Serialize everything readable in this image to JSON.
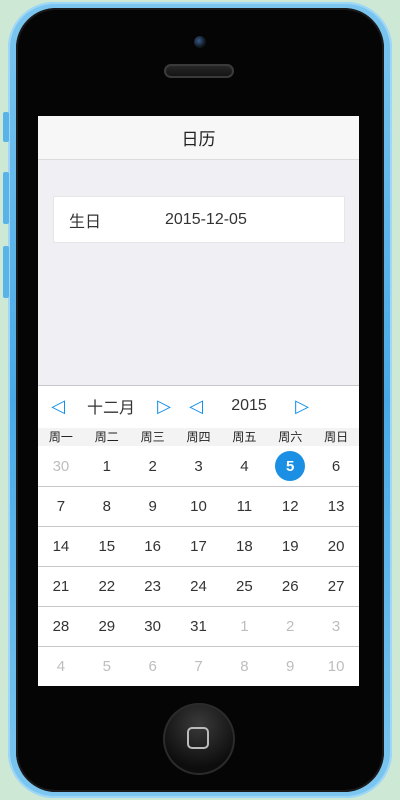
{
  "navbar": {
    "title": "日历"
  },
  "field": {
    "label": "生日",
    "value": "2015-12-05"
  },
  "calendar": {
    "prev_month_icon": "left-triangle-icon",
    "next_month_icon": "right-triangle-icon",
    "prev_year_icon": "left-triangle-icon",
    "next_year_icon": "right-triangle-icon",
    "month": "十二月",
    "year": "2015",
    "weekdays": [
      "周一",
      "周二",
      "周三",
      "周四",
      "周五",
      "周六",
      "周日"
    ],
    "selected_color": "#1a8fe3",
    "weeks": [
      [
        {
          "d": "30",
          "m": true
        },
        {
          "d": "1"
        },
        {
          "d": "2"
        },
        {
          "d": "3"
        },
        {
          "d": "4"
        },
        {
          "d": "5",
          "sel": true
        },
        {
          "d": "6"
        }
      ],
      [
        {
          "d": "7"
        },
        {
          "d": "8"
        },
        {
          "d": "9"
        },
        {
          "d": "10"
        },
        {
          "d": "11"
        },
        {
          "d": "12"
        },
        {
          "d": "13"
        }
      ],
      [
        {
          "d": "14"
        },
        {
          "d": "15"
        },
        {
          "d": "16"
        },
        {
          "d": "17"
        },
        {
          "d": "18"
        },
        {
          "d": "19"
        },
        {
          "d": "20"
        }
      ],
      [
        {
          "d": "21"
        },
        {
          "d": "22"
        },
        {
          "d": "23"
        },
        {
          "d": "24"
        },
        {
          "d": "25"
        },
        {
          "d": "26"
        },
        {
          "d": "27"
        }
      ],
      [
        {
          "d": "28"
        },
        {
          "d": "29"
        },
        {
          "d": "30"
        },
        {
          "d": "31"
        },
        {
          "d": "1",
          "m": true
        },
        {
          "d": "2",
          "m": true
        },
        {
          "d": "3",
          "m": true
        }
      ],
      [
        {
          "d": "4",
          "m": true
        },
        {
          "d": "5",
          "m": true
        },
        {
          "d": "6",
          "m": true
        },
        {
          "d": "7",
          "m": true
        },
        {
          "d": "8",
          "m": true
        },
        {
          "d": "9",
          "m": true
        },
        {
          "d": "10",
          "m": true
        }
      ]
    ]
  }
}
